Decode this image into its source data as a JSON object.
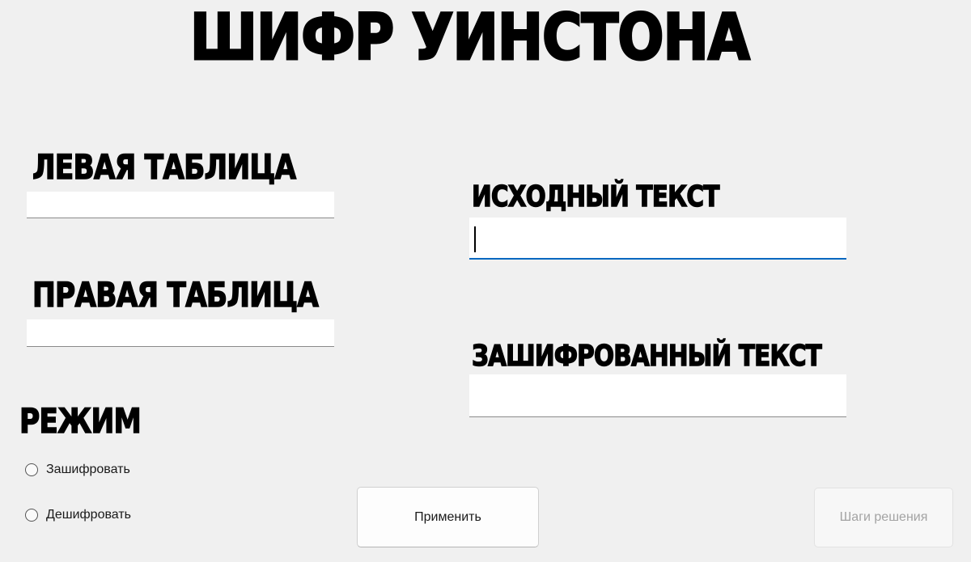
{
  "title": "ШИФР УИНСТОНА",
  "left_table": {
    "label": "ЛЕВАЯ ТАБЛИЦА",
    "value": ""
  },
  "right_table": {
    "label": "ПРАВАЯ ТАБЛИЦА",
    "value": ""
  },
  "source_text": {
    "label": "ИСХОДНЫЙ ТЕКСТ",
    "value": "",
    "focused": true
  },
  "encrypted_text": {
    "label": "ЗАШИФРОВАННЫЙ ТЕКСТ",
    "value": ""
  },
  "mode": {
    "label": "РЕЖИМ",
    "options": [
      {
        "label": "Зашифровать",
        "selected": false
      },
      {
        "label": "Дешифровать",
        "selected": false
      }
    ]
  },
  "buttons": {
    "apply_label": "Применить",
    "steps_label": "Шаги решения",
    "steps_enabled": false
  },
  "colors": {
    "background": "#f0f0f0",
    "focus_accent": "#0067c0",
    "disabled_text": "#a3a3a3"
  }
}
